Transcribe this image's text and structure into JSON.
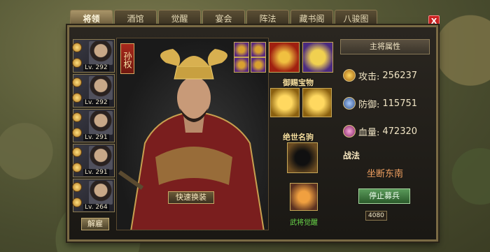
{
  "tabs": [
    {
      "label": "将领",
      "active": true
    },
    {
      "label": "酒馆",
      "active": false
    },
    {
      "label": "觉醒",
      "active": false
    },
    {
      "label": "宴会",
      "active": false
    },
    {
      "label": "阵法",
      "active": false
    },
    {
      "label": "藏书阁",
      "active": false
    },
    {
      "label": "八骏图",
      "active": false
    }
  ],
  "close_label": "X",
  "roster": [
    {
      "level": "Lv. 292",
      "icon": "general-portrait-icon"
    },
    {
      "level": "Lv. 292",
      "icon": "general-portrait-icon"
    },
    {
      "level": "Lv. 291",
      "icon": "general-portrait-icon"
    },
    {
      "level": "Lv. 291",
      "icon": "general-portrait-icon"
    },
    {
      "level": "Lv. 264",
      "icon": "general-portrait-icon"
    }
  ],
  "disband_label": "解雇",
  "hero_name": "孙权",
  "swap_label": "快速换装",
  "equipment": {
    "bestowed_treasure_label": "御赐宝物",
    "steed_label": "绝世名驹",
    "awaken_label": "武将觉醒"
  },
  "stats": {
    "title": "主将属性",
    "attack": {
      "label": "攻击:",
      "value": "256237",
      "icon": "sword-icon"
    },
    "defense": {
      "label": "防御:",
      "value": "115751",
      "icon": "shield-icon"
    },
    "hp": {
      "label": "血量:",
      "value": "472320",
      "icon": "heart-icon"
    }
  },
  "skill": {
    "header": "战法",
    "name": "坐断东南",
    "stop_label": "停止募兵",
    "troop_count": "4080"
  }
}
